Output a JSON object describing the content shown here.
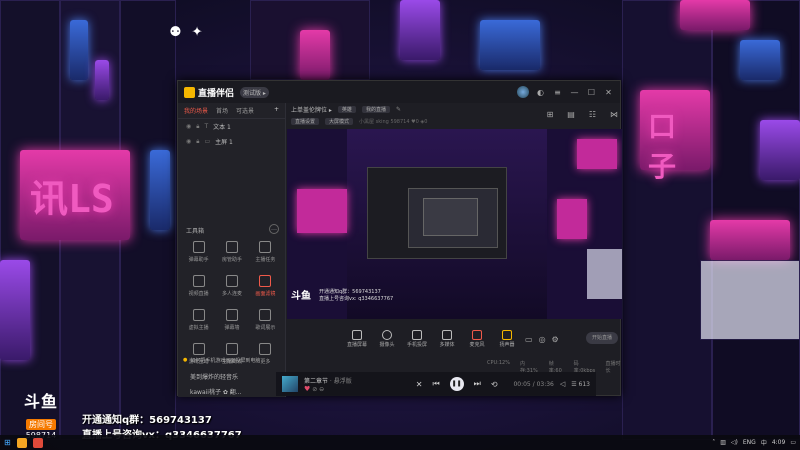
{
  "app": {
    "name": "直播伴侣",
    "version_badge": "测试版 ▸",
    "left_tabs": [
      "我的场景",
      "首场",
      "可选景"
    ],
    "scenes": [
      {
        "label": "文本 1"
      },
      {
        "label": "主屏 1"
      }
    ],
    "tools_title": "工具箱",
    "tools": [
      {
        "label": "弹幕助手",
        "hot": false
      },
      {
        "label": "房管助手",
        "hot": false
      },
      {
        "label": "主播任务",
        "hot": false
      },
      {
        "label": "视频直播",
        "hot": false
      },
      {
        "label": "多人连麦",
        "hot": false
      },
      {
        "label": "画面滤镜",
        "hot": true
      },
      {
        "label": "虚拟主播",
        "hot": false
      },
      {
        "label": "弹幕墙",
        "hot": false
      },
      {
        "label": "歌词展示",
        "hot": false
      },
      {
        "label": "游戏互动",
        "hot": false
      },
      {
        "label": "主播商城",
        "hot": false
      },
      {
        "label": "更多",
        "hot": false
      }
    ],
    "notice": "如何把手机游戏画面投屏到电脑",
    "topbar": {
      "stream_title": "上单盖伦牌位 ▸",
      "category_pill": "英雄",
      "room_pill": "我的直播",
      "sub_pill": "直播设置",
      "sub_pill2": "大屏模式",
      "stats": "小黑屋 sking   598714   ♥0   ◈0"
    },
    "preview_caption_line1": "开通通知q群：569743137",
    "preview_caption_line2": "直播上号咨询vx: q3346637767",
    "preview_logo": "斗鱼",
    "controls": [
      {
        "label": "直播屏幕"
      },
      {
        "label": "摄像头"
      },
      {
        "label": "手机投屏"
      },
      {
        "label": "多媒体"
      },
      {
        "label": "麦克风"
      },
      {
        "label": "扬声器"
      }
    ],
    "go_live": "开始直播",
    "status": [
      "CPU:12%",
      "内存:31%",
      "帧率:60",
      "码率:0kbps"
    ],
    "status_right": "直播时长"
  },
  "music": {
    "user_line1": "美到爆炸的轻音乐",
    "user_line2": "kawaii桃子 ✿ 翻...",
    "song": "第二章节",
    "artist": " · 悬浮版",
    "time": "00:05 / 03:36",
    "list_count": "☰ 613"
  },
  "branding": {
    "logo": "斗鱼",
    "sub": "房间号",
    "room": "598714",
    "ad_line1": "开通通知q群：569743137",
    "ad_line2": "直播上号咨询vx：q3346637767"
  },
  "taskbar": {
    "tray_lang": "ENG",
    "tray_time": "4:09"
  },
  "colors": {
    "accent": "#f05a4a",
    "brand": "#f5b700",
    "neon": "#e43aa8"
  }
}
